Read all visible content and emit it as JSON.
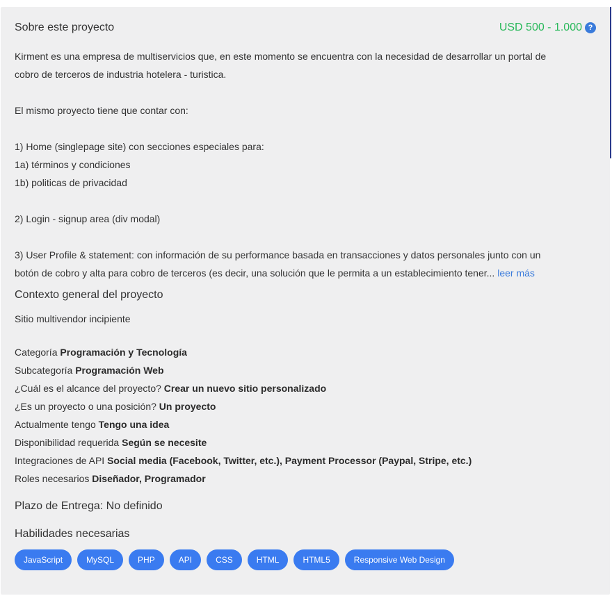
{
  "header": {
    "title": "Sobre este proyecto",
    "budget": "USD 500 - 1.000",
    "help_icon_glyph": "?"
  },
  "description": {
    "lines": [
      "Kirment es una empresa de multiservicios que, en este momento se encuentra con la necesidad de desarrollar un portal de",
      "cobro de terceros de industria hotelera - turistica.",
      "",
      "El mismo proyecto tiene que contar con:",
      "",
      "1) Home (singlepage site) con secciones especiales para:",
      "1a) términos y condiciones",
      "1b) politicas de privacidad",
      "",
      "2) Login - signup area (div modal)",
      "",
      "3) User Profile & statement: con información de su performance basada en transacciones y datos personales junto con un",
      "botón de cobro y alta para cobro de terceros (es decir, una solución que le permita a un establecimiento tener..."
    ],
    "read_more": "leer más"
  },
  "context": {
    "title": "Contexto general del proyecto",
    "text": "Sitio multivendor incipiente"
  },
  "details": [
    {
      "label": "Categoría",
      "value": "Programación y Tecnología"
    },
    {
      "label": "Subcategoría",
      "value": "Programación Web"
    },
    {
      "label": "¿Cuál es el alcance del proyecto?",
      "value": "Crear un nuevo sitio personalizado"
    },
    {
      "label": "¿Es un proyecto o una posición?",
      "value": "Un proyecto"
    },
    {
      "label": "Actualmente tengo",
      "value": "Tengo una idea"
    },
    {
      "label": "Disponibilidad requerida",
      "value": "Según se necesite"
    },
    {
      "label": "Integraciones de API",
      "value": "Social media (Facebook, Twitter, etc.), Payment Processor (Paypal, Stripe, etc.)"
    },
    {
      "label": "Roles necesarios",
      "value": "Diseñador, Programador"
    }
  ],
  "deadline": "Plazo de Entrega: No definido",
  "skills": {
    "title": "Habilidades necesarias",
    "items": [
      "JavaScript",
      "MySQL",
      "PHP",
      "API",
      "CSS",
      "HTML",
      "HTML5",
      "Responsive Web Design"
    ]
  },
  "colors": {
    "budget": "#28b85a",
    "accent": "#3a7bf0",
    "card_background": "#efeff0"
  }
}
